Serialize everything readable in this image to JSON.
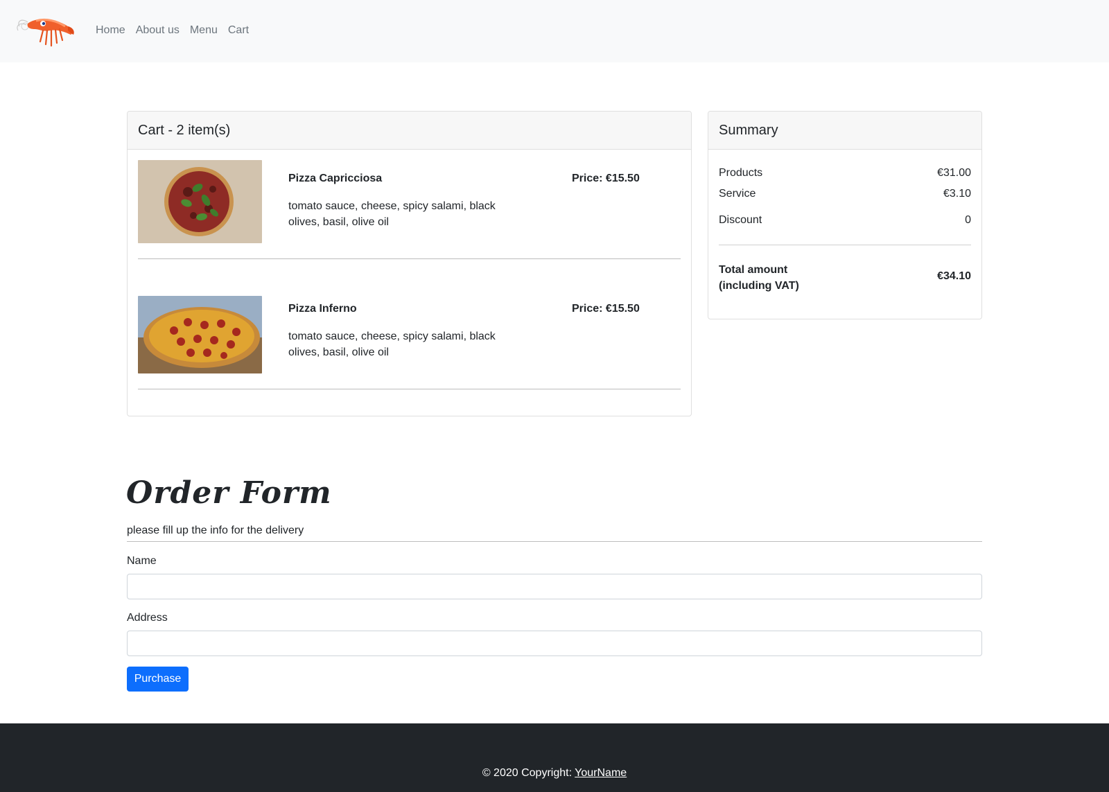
{
  "navbar": {
    "brand_icon": "shrimp-logo",
    "links": [
      {
        "label": "Home"
      },
      {
        "label": "About us"
      },
      {
        "label": "Menu"
      },
      {
        "label": "Cart"
      }
    ]
  },
  "cart": {
    "title": "Cart - 2 item(s)",
    "items": [
      {
        "name": "Pizza Capricciosa",
        "description": "tomato sauce, cheese, spicy salami, black olives, basil, olive oil",
        "price": "Price: €15.50",
        "image": "pizza-with-basil-photo"
      },
      {
        "name": "Pizza Inferno",
        "description": "tomato sauce, cheese, spicy salami, black olives, basil, olive oil",
        "price": "Price: €15.50",
        "image": "pepperoni-pizza-photo"
      }
    ]
  },
  "summary": {
    "title": "Summary",
    "rows": [
      {
        "label": "Products",
        "value": "€31.00"
      },
      {
        "label": "Service",
        "value": "€3.10"
      },
      {
        "label": "Discount",
        "value": "0"
      }
    ],
    "total_label_line1": "Total amount",
    "total_label_line2": "(including VAT)",
    "total_value": "€34.10"
  },
  "order_form": {
    "title": "Order Form",
    "subtitle": "please fill up the info for the delivery",
    "name_label": "Name",
    "name_value": "",
    "address_label": "Address",
    "address_value": "",
    "submit_label": "Purchase"
  },
  "footer": {
    "copyright_prefix": "© 2020 Copyright: ",
    "link_label": "YourName"
  },
  "colors": {
    "navbar_bg": "#f8f9fa",
    "primary": "#0d6efd",
    "footer_bg": "#212529"
  }
}
